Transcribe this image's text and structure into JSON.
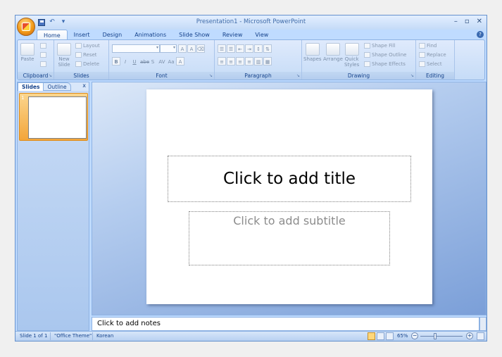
{
  "window": {
    "title": "Presentation1 - Microsoft PowerPoint",
    "controls": [
      "–",
      "▫",
      "✕"
    ]
  },
  "qat": {
    "undo": "↶",
    "dropdown": "▾"
  },
  "tabs": [
    "Home",
    "Insert",
    "Design",
    "Animations",
    "Slide Show",
    "Review",
    "View"
  ],
  "ribbon": {
    "clipboard": {
      "label": "Clipboard",
      "paste": "Paste"
    },
    "slides": {
      "label": "Slides",
      "new_slide": "New",
      "new_slide_2": "Slide",
      "layout": "Layout",
      "reset": "Reset",
      "delete": "Delete"
    },
    "font": {
      "label": "Font",
      "bold": "B",
      "italic": "I",
      "underline": "U",
      "strike": "abe",
      "shadow": "S",
      "spacing": "AV",
      "case": "Aa",
      "color": "A",
      "grow": "A",
      "shrink": "A"
    },
    "paragraph": {
      "label": "Paragraph"
    },
    "drawing": {
      "label": "Drawing",
      "shapes": "Shapes",
      "arrange": "Arrange",
      "quick": "Quick",
      "styles": "Styles",
      "shape_fill": "Shape Fill",
      "shape_outline": "Shape Outline",
      "shape_effects": "Shape Effects"
    },
    "editing": {
      "label": "Editing",
      "find": "Find",
      "replace": "Replace",
      "select": "Select"
    }
  },
  "left_pane": {
    "tab_slides": "Slides",
    "tab_outline": "Outline",
    "close": "x",
    "slide_number": "1"
  },
  "slide": {
    "title_placeholder": "Click to add title",
    "subtitle_placeholder": "Click to add subtitle"
  },
  "notes": {
    "placeholder": "Click to add notes"
  },
  "status": {
    "slide": "Slide 1 of 1",
    "theme": "\"Office Theme\"",
    "language": "Korean",
    "zoom": "65%",
    "zoom_out": "−",
    "zoom_in": "+"
  }
}
